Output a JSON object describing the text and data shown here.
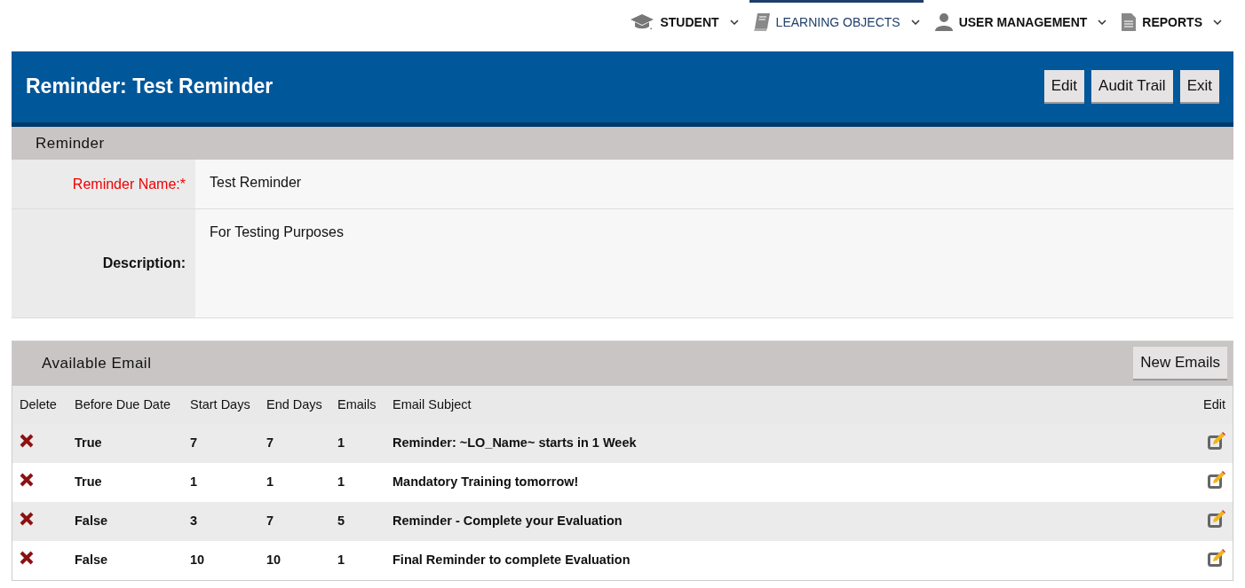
{
  "nav": [
    {
      "label": "STUDENT",
      "selected": false
    },
    {
      "label": "LEARNING OBJECTS",
      "selected": true
    },
    {
      "label": "USER MANAGEMENT",
      "selected": false
    },
    {
      "label": "REPORTS",
      "selected": false
    }
  ],
  "header": {
    "title": "Reminder: Test Reminder",
    "buttons": [
      "Edit",
      "Audit Trail",
      "Exit"
    ]
  },
  "reminder": {
    "title": "Reminder",
    "fields": [
      {
        "label": "Reminder Name:*",
        "value": "Test Reminder",
        "required": true,
        "tall": false
      },
      {
        "label": "Description:",
        "value": "For Testing Purposes",
        "required": false,
        "tall": true
      }
    ]
  },
  "emails": {
    "title": "Available Email",
    "button": "New Emails",
    "columns": [
      "Delete",
      "Before Due Date",
      "Start Days",
      "End Days",
      "Emails",
      "Email Subject",
      "Edit"
    ],
    "rows": [
      {
        "before_due_date": "True",
        "start_days": "7",
        "end_days": "7",
        "emails": "1",
        "subject": "Reminder: ~LO_Name~ starts in 1 Week"
      },
      {
        "before_due_date": "True",
        "start_days": "1",
        "end_days": "1",
        "emails": "1",
        "subject": "Mandatory Training tomorrow!"
      },
      {
        "before_due_date": "False",
        "start_days": "3",
        "end_days": "7",
        "emails": "5",
        "subject": "Reminder - Complete your Evaluation"
      },
      {
        "before_due_date": "False",
        "start_days": "10",
        "end_days": "10",
        "emails": "1",
        "subject": "Final Reminder to complete Evaluation"
      }
    ]
  }
}
